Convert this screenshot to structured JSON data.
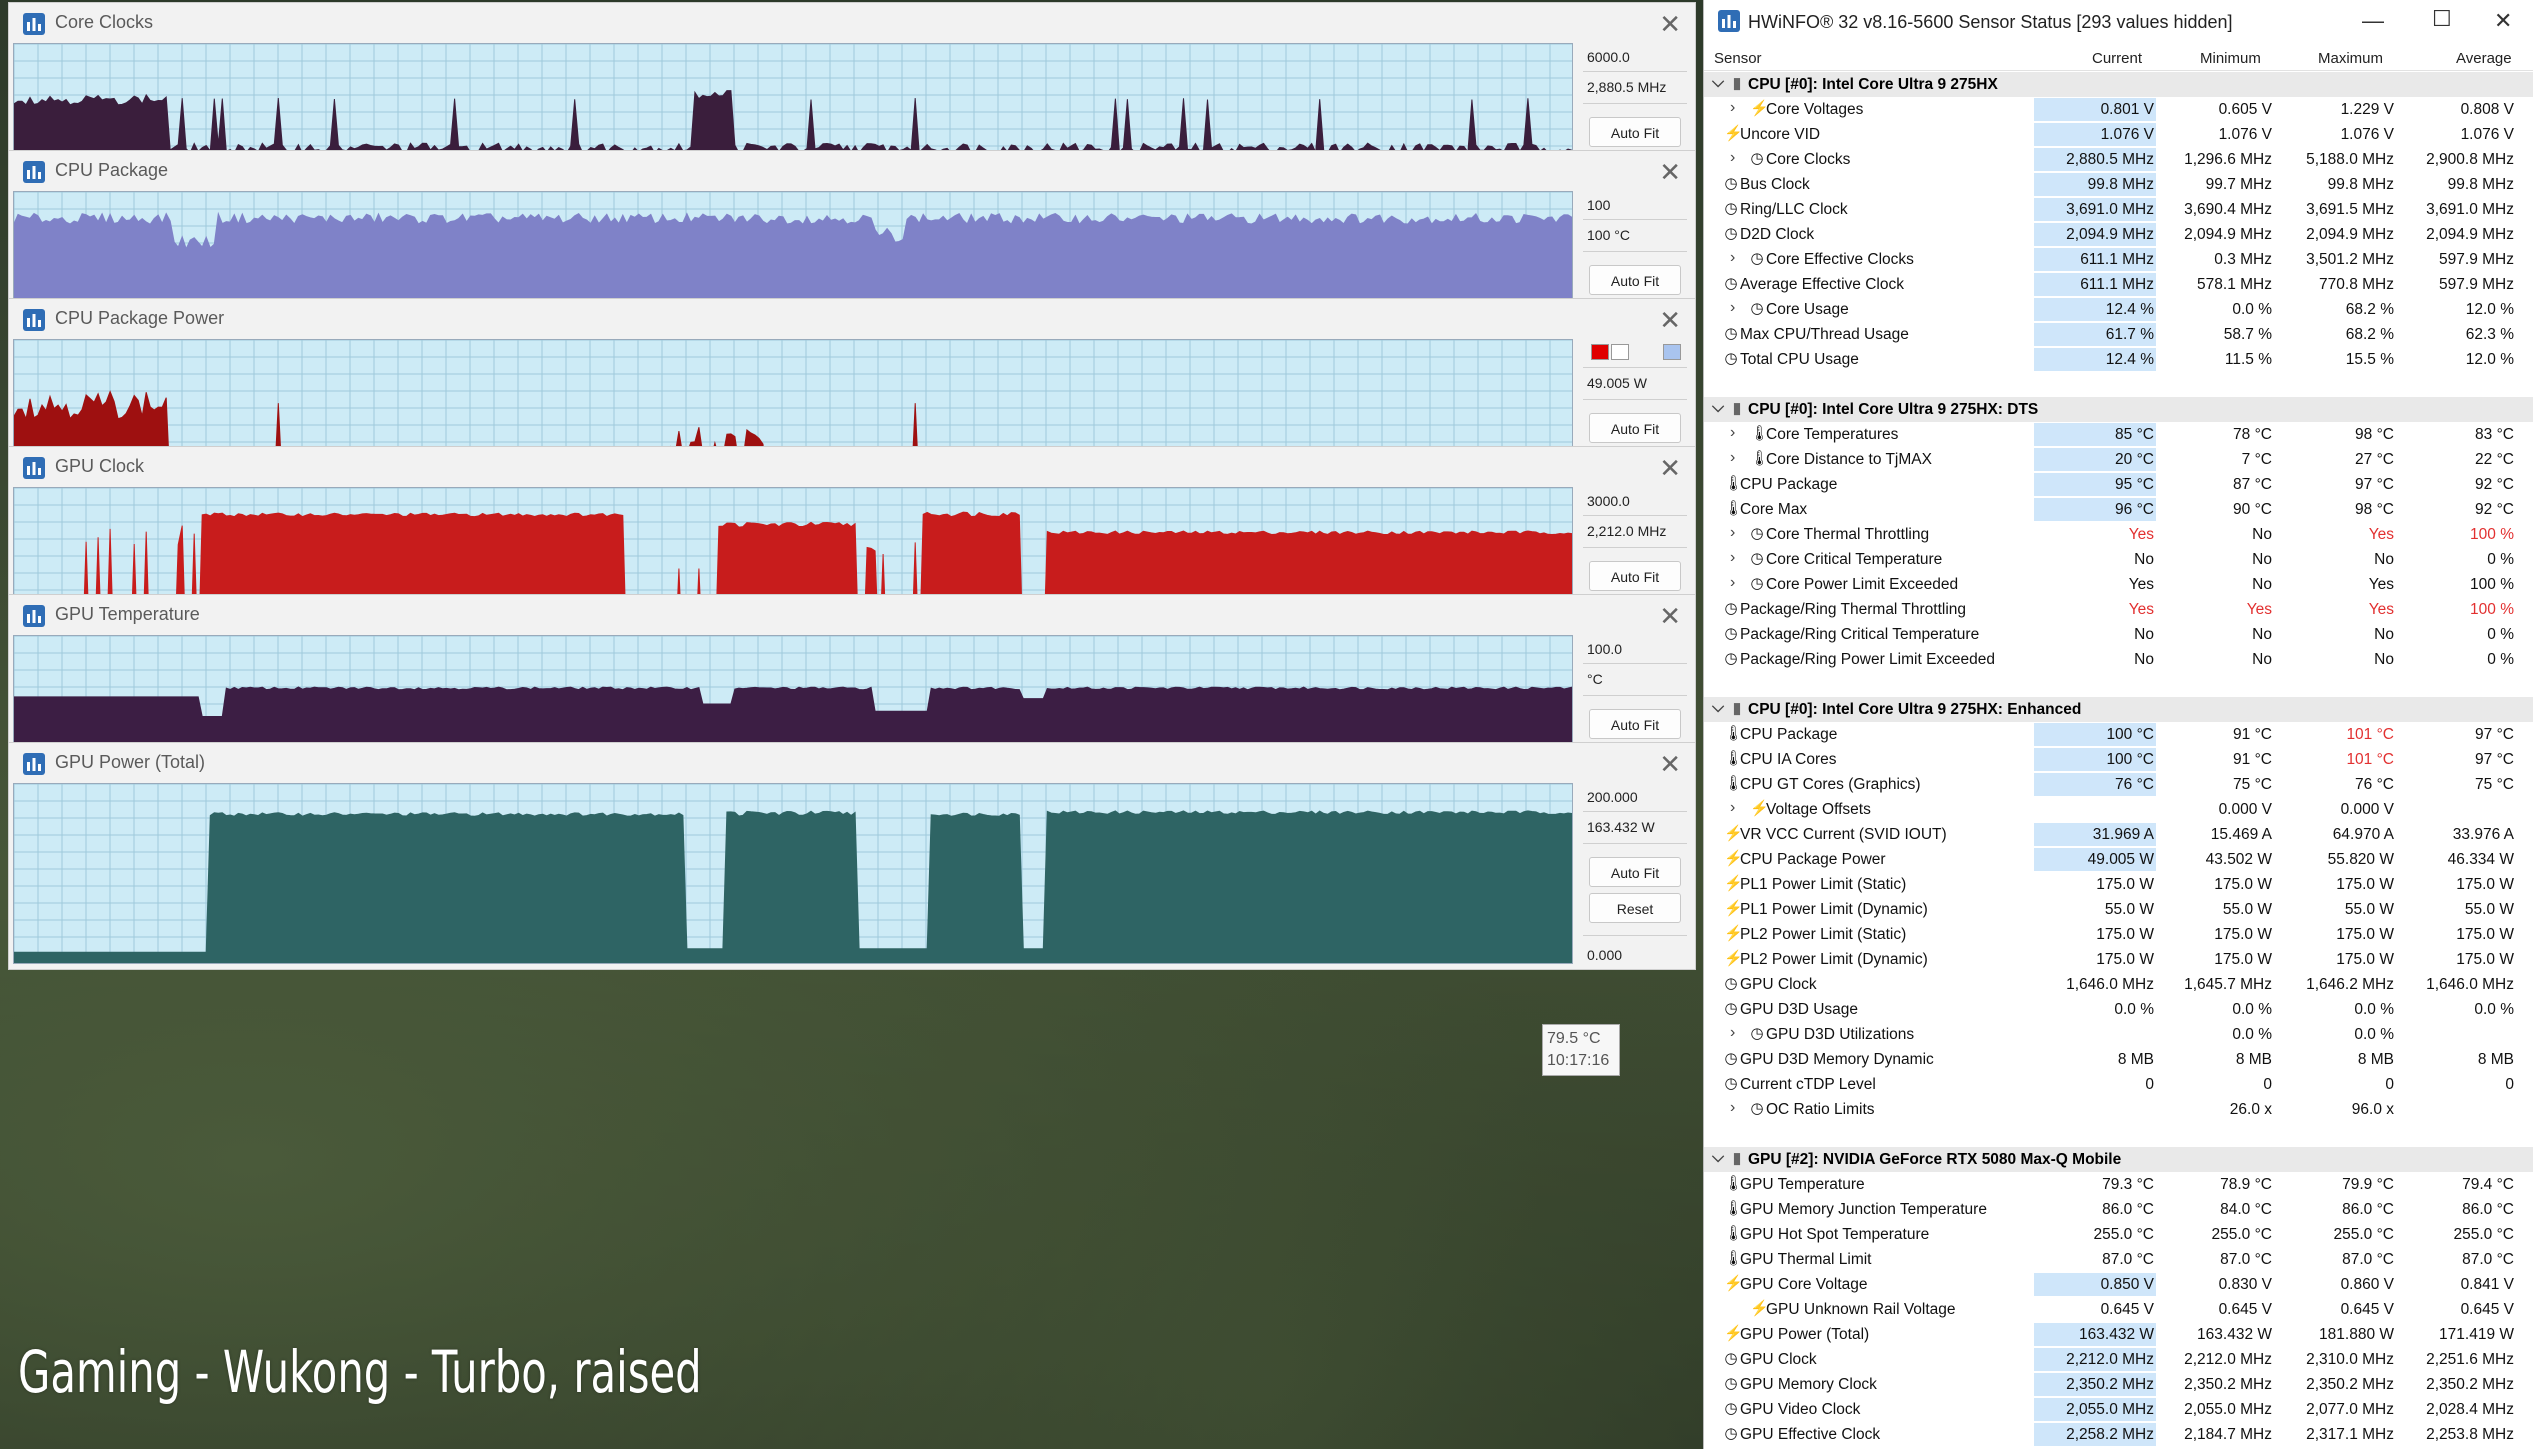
{
  "graphs": [
    {
      "title": "Core Clocks",
      "max_label": "6000.0",
      "cur_label": "2,880.5 MHz",
      "min_label": "0.0",
      "color": "#3a1e3c",
      "shape": "cpuclock",
      "legend": false
    },
    {
      "title": "CPU Package",
      "max_label": "100",
      "cur_label": "100 °C",
      "min_label": "0",
      "color": "#7f82c8",
      "shape": "cpupkg",
      "legend": false
    },
    {
      "title": "CPU Package Power",
      "max_label": "",
      "cur_label": "49.005 W",
      "min_label": "0.000",
      "color": "#9e1010",
      "shape": "cpupower",
      "legend": true
    },
    {
      "title": "GPU Clock",
      "max_label": "3000.0",
      "cur_label": "2,212.0 MHz",
      "min_label": "0.0",
      "color": "#c81c1c",
      "shape": "gpuclock",
      "legend": false
    },
    {
      "title": "GPU Temperature",
      "max_label": "100.0",
      "cur_label": "°C",
      "min_label": "0.0",
      "color": "#3c1e44",
      "shape": "gputemp",
      "legend": false
    },
    {
      "title": "GPU Power (Total)",
      "max_label": "200.000",
      "cur_label": "163.432 W",
      "min_label": "0.000",
      "color": "#2e6464",
      "shape": "gpupower",
      "legend": false
    }
  ],
  "buttons": {
    "autofit": "Auto Fit",
    "reset": "Reset"
  },
  "tooltip": {
    "value": "79.5 °C",
    "time": "10:17:16"
  },
  "caption": "Gaming - Wukong - Turbo, raised",
  "sensor": {
    "title": "HWiNFO® 32 v8.16-5600 Sensor Status [293 values hidden]",
    "columns": {
      "sensor": "Sensor",
      "current": "Current",
      "minimum": "Minimum",
      "maximum": "Maximum",
      "average": "Average"
    },
    "rows": [
      {
        "type": "group",
        "label": "CPU [#0]: Intel Core Ultra 9 275HX"
      },
      {
        "type": "item",
        "exp": true,
        "indent": 2,
        "icon": "bolt",
        "label": "Core Voltages",
        "cur": "0.801 V",
        "min": "0.605 V",
        "max": "1.229 V",
        "avg": "0.808 V",
        "hl": true
      },
      {
        "type": "item",
        "indent": 1,
        "icon": "bolt",
        "label": "Uncore VID",
        "cur": "1.076 V",
        "min": "1.076 V",
        "max": "1.076 V",
        "avg": "1.076 V",
        "hl": true
      },
      {
        "type": "item",
        "exp": true,
        "indent": 2,
        "icon": "clock",
        "label": "Core Clocks",
        "cur": "2,880.5 MHz",
        "min": "1,296.6 MHz",
        "max": "5,188.0 MHz",
        "avg": "2,900.8 MHz",
        "hl": true
      },
      {
        "type": "item",
        "indent": 1,
        "icon": "clock",
        "label": "Bus Clock",
        "cur": "99.8 MHz",
        "min": "99.7 MHz",
        "max": "99.8 MHz",
        "avg": "99.8 MHz",
        "hl": true
      },
      {
        "type": "item",
        "indent": 1,
        "icon": "clock",
        "label": "Ring/LLC Clock",
        "cur": "3,691.0 MHz",
        "min": "3,690.4 MHz",
        "max": "3,691.5 MHz",
        "avg": "3,691.0 MHz",
        "hl": true
      },
      {
        "type": "item",
        "indent": 1,
        "icon": "clock",
        "label": "D2D Clock",
        "cur": "2,094.9 MHz",
        "min": "2,094.9 MHz",
        "max": "2,094.9 MHz",
        "avg": "2,094.9 MHz",
        "hl": true
      },
      {
        "type": "item",
        "exp": true,
        "indent": 2,
        "icon": "clock",
        "label": "Core Effective Clocks",
        "cur": "611.1 MHz",
        "min": "0.3 MHz",
        "max": "3,501.2 MHz",
        "avg": "597.9 MHz",
        "hl": true
      },
      {
        "type": "item",
        "indent": 1,
        "icon": "clock",
        "label": "Average Effective Clock",
        "cur": "611.1 MHz",
        "min": "578.1 MHz",
        "max": "770.8 MHz",
        "avg": "597.9 MHz",
        "hl": true
      },
      {
        "type": "item",
        "exp": true,
        "indent": 2,
        "icon": "clock",
        "label": "Core Usage",
        "cur": "12.4 %",
        "min": "0.0 %",
        "max": "68.2 %",
        "avg": "12.0 %",
        "hl": true
      },
      {
        "type": "item",
        "indent": 1,
        "icon": "clock",
        "label": "Max CPU/Thread Usage",
        "cur": "61.7 %",
        "min": "58.7 %",
        "max": "68.2 %",
        "avg": "62.3 %",
        "hl": true
      },
      {
        "type": "item",
        "indent": 1,
        "icon": "clock",
        "label": "Total CPU Usage",
        "cur": "12.4 %",
        "min": "11.5 %",
        "max": "15.5 %",
        "avg": "12.0 %",
        "hl": true
      },
      {
        "type": "spacer"
      },
      {
        "type": "group",
        "label": "CPU [#0]: Intel Core Ultra 9 275HX: DTS"
      },
      {
        "type": "item",
        "exp": true,
        "indent": 2,
        "icon": "therm",
        "label": "Core Temperatures",
        "cur": "85 °C",
        "min": "78 °C",
        "max": "98 °C",
        "avg": "83 °C",
        "hl": true
      },
      {
        "type": "item",
        "exp": true,
        "indent": 2,
        "icon": "therm",
        "label": "Core Distance to TjMAX",
        "cur": "20 °C",
        "min": "7 °C",
        "max": "27 °C",
        "avg": "22 °C",
        "hl": true
      },
      {
        "type": "item",
        "indent": 1,
        "icon": "therm",
        "label": "CPU Package",
        "cur": "95 °C",
        "min": "87 °C",
        "max": "97 °C",
        "avg": "92 °C",
        "hl": true
      },
      {
        "type": "item",
        "indent": 1,
        "icon": "therm",
        "label": "Core Max",
        "cur": "96 °C",
        "min": "90 °C",
        "max": "98 °C",
        "avg": "92 °C",
        "hl": true
      },
      {
        "type": "item",
        "exp": true,
        "indent": 2,
        "icon": "clock",
        "label": "Core Thermal Throttling",
        "cur": "Yes",
        "min": "No",
        "max": "Yes",
        "avg": "100 %",
        "red": [
          "cur",
          "max",
          "avg"
        ]
      },
      {
        "type": "item",
        "exp": true,
        "indent": 2,
        "icon": "clock",
        "label": "Core Critical Temperature",
        "cur": "No",
        "min": "No",
        "max": "No",
        "avg": "0 %"
      },
      {
        "type": "item",
        "exp": true,
        "indent": 2,
        "icon": "clock",
        "label": "Core Power Limit Exceeded",
        "cur": "Yes",
        "min": "No",
        "max": "Yes",
        "avg": "100 %"
      },
      {
        "type": "item",
        "indent": 1,
        "icon": "clock",
        "label": "Package/Ring Thermal Throttling",
        "cur": "Yes",
        "min": "Yes",
        "max": "Yes",
        "avg": "100 %",
        "red": [
          "cur",
          "min",
          "max",
          "avg"
        ]
      },
      {
        "type": "item",
        "indent": 1,
        "icon": "clock",
        "label": "Package/Ring Critical Temperature",
        "cur": "No",
        "min": "No",
        "max": "No",
        "avg": "0 %"
      },
      {
        "type": "item",
        "indent": 1,
        "icon": "clock",
        "label": "Package/Ring Power Limit Exceeded",
        "cur": "No",
        "min": "No",
        "max": "No",
        "avg": "0 %"
      },
      {
        "type": "spacer"
      },
      {
        "type": "group",
        "label": "CPU [#0]: Intel Core Ultra 9 275HX: Enhanced"
      },
      {
        "type": "item",
        "indent": 1,
        "icon": "therm",
        "label": "CPU Package",
        "cur": "100 °C",
        "min": "91 °C",
        "max": "101 °C",
        "avg": "97 °C",
        "hl": true,
        "red": [
          "max"
        ]
      },
      {
        "type": "item",
        "indent": 1,
        "icon": "therm",
        "label": "CPU IA Cores",
        "cur": "100 °C",
        "min": "91 °C",
        "max": "101 °C",
        "avg": "97 °C",
        "hl": true,
        "red": [
          "max"
        ]
      },
      {
        "type": "item",
        "indent": 1,
        "icon": "therm",
        "label": "CPU GT Cores (Graphics)",
        "cur": "76 °C",
        "min": "75 °C",
        "max": "76 °C",
        "avg": "75 °C",
        "hl": true
      },
      {
        "type": "item",
        "exp": true,
        "indent": 2,
        "icon": "bolt",
        "label": "Voltage Offsets",
        "cur": "",
        "min": "0.000 V",
        "max": "0.000 V",
        "avg": ""
      },
      {
        "type": "item",
        "indent": 1,
        "icon": "bolt",
        "label": "VR VCC Current (SVID IOUT)",
        "cur": "31.969 A",
        "min": "15.469 A",
        "max": "64.970 A",
        "avg": "33.976 A",
        "hl": true
      },
      {
        "type": "item",
        "indent": 1,
        "icon": "bolt",
        "label": "CPU Package Power",
        "cur": "49.005 W",
        "min": "43.502 W",
        "max": "55.820 W",
        "avg": "46.334 W",
        "hl": true
      },
      {
        "type": "item",
        "indent": 1,
        "icon": "bolt",
        "label": "PL1 Power Limit (Static)",
        "cur": "175.0 W",
        "min": "175.0 W",
        "max": "175.0 W",
        "avg": "175.0 W"
      },
      {
        "type": "item",
        "indent": 1,
        "icon": "bolt",
        "label": "PL1 Power Limit (Dynamic)",
        "cur": "55.0 W",
        "min": "55.0 W",
        "max": "55.0 W",
        "avg": "55.0 W"
      },
      {
        "type": "item",
        "indent": 1,
        "icon": "bolt",
        "label": "PL2 Power Limit (Static)",
        "cur": "175.0 W",
        "min": "175.0 W",
        "max": "175.0 W",
        "avg": "175.0 W"
      },
      {
        "type": "item",
        "indent": 1,
        "icon": "bolt",
        "label": "PL2 Power Limit (Dynamic)",
        "cur": "175.0 W",
        "min": "175.0 W",
        "max": "175.0 W",
        "avg": "175.0 W"
      },
      {
        "type": "item",
        "indent": 1,
        "icon": "clock",
        "label": "GPU Clock",
        "cur": "1,646.0 MHz",
        "min": "1,645.7 MHz",
        "max": "1,646.2 MHz",
        "avg": "1,646.0 MHz"
      },
      {
        "type": "item",
        "indent": 1,
        "icon": "clock",
        "label": "GPU D3D Usage",
        "cur": "0.0 %",
        "min": "0.0 %",
        "max": "0.0 %",
        "avg": "0.0 %"
      },
      {
        "type": "item",
        "exp": true,
        "indent": 2,
        "icon": "clock",
        "label": "GPU D3D Utilizations",
        "cur": "",
        "min": "0.0 %",
        "max": "0.0 %",
        "avg": ""
      },
      {
        "type": "item",
        "indent": 1,
        "icon": "clock",
        "label": "GPU D3D Memory Dynamic",
        "cur": "8 MB",
        "min": "8 MB",
        "max": "8 MB",
        "avg": "8 MB"
      },
      {
        "type": "item",
        "indent": 1,
        "icon": "clock",
        "label": "Current cTDP Level",
        "cur": "0",
        "min": "0",
        "max": "0",
        "avg": "0"
      },
      {
        "type": "item",
        "exp": true,
        "indent": 2,
        "icon": "clock",
        "label": "OC Ratio Limits",
        "cur": "",
        "min": "26.0 x",
        "max": "96.0 x",
        "avg": ""
      },
      {
        "type": "spacer"
      },
      {
        "type": "group",
        "label": "GPU [#2]: NVIDIA  GeForce RTX 5080 Max-Q Mobile"
      },
      {
        "type": "item",
        "indent": 1,
        "icon": "therm",
        "label": "GPU Temperature",
        "cur": "79.3 °C",
        "min": "78.9 °C",
        "max": "79.9 °C",
        "avg": "79.4 °C"
      },
      {
        "type": "item",
        "indent": 1,
        "icon": "therm",
        "label": "GPU Memory Junction Temperature",
        "cur": "86.0 °C",
        "min": "84.0 °C",
        "max": "86.0 °C",
        "avg": "86.0 °C"
      },
      {
        "type": "item",
        "indent": 1,
        "icon": "therm",
        "label": "GPU Hot Spot Temperature",
        "cur": "255.0 °C",
        "min": "255.0 °C",
        "max": "255.0 °C",
        "avg": "255.0 °C"
      },
      {
        "type": "item",
        "indent": 1,
        "icon": "therm",
        "label": "GPU Thermal Limit",
        "cur": "87.0 °C",
        "min": "87.0 °C",
        "max": "87.0 °C",
        "avg": "87.0 °C"
      },
      {
        "type": "item",
        "indent": 1,
        "icon": "bolt",
        "label": "GPU Core Voltage",
        "cur": "0.850 V",
        "min": "0.830 V",
        "max": "0.860 V",
        "avg": "0.841 V",
        "hl": true
      },
      {
        "type": "item",
        "indent": 2,
        "icon": "bolt",
        "label": "GPU Unknown Rail Voltage",
        "cur": "0.645 V",
        "min": "0.645 V",
        "max": "0.645 V",
        "avg": "0.645 V"
      },
      {
        "type": "item",
        "indent": 1,
        "icon": "bolt",
        "label": "GPU Power (Total)",
        "cur": "163.432 W",
        "min": "163.432 W",
        "max": "181.880 W",
        "avg": "171.419 W",
        "hl": true
      },
      {
        "type": "item",
        "indent": 1,
        "icon": "clock",
        "label": "GPU Clock",
        "cur": "2,212.0 MHz",
        "min": "2,212.0 MHz",
        "max": "2,310.0 MHz",
        "avg": "2,251.6 MHz",
        "hl": true
      },
      {
        "type": "item",
        "indent": 1,
        "icon": "clock",
        "label": "GPU Memory Clock",
        "cur": "2,350.2 MHz",
        "min": "2,350.2 MHz",
        "max": "2,350.2 MHz",
        "avg": "2,350.2 MHz",
        "hl": true
      },
      {
        "type": "item",
        "indent": 1,
        "icon": "clock",
        "label": "GPU Video Clock",
        "cur": "2,055.0 MHz",
        "min": "2,055.0 MHz",
        "max": "2,077.0 MHz",
        "avg": "2,028.4 MHz",
        "hl": true
      },
      {
        "type": "item",
        "indent": 1,
        "icon": "clock",
        "label": "GPU Effective Clock",
        "cur": "2,258.2 MHz",
        "min": "2,184.7 MHz",
        "max": "2,317.1 MHz",
        "avg": "2,253.8 MHz",
        "hl": true
      }
    ]
  }
}
